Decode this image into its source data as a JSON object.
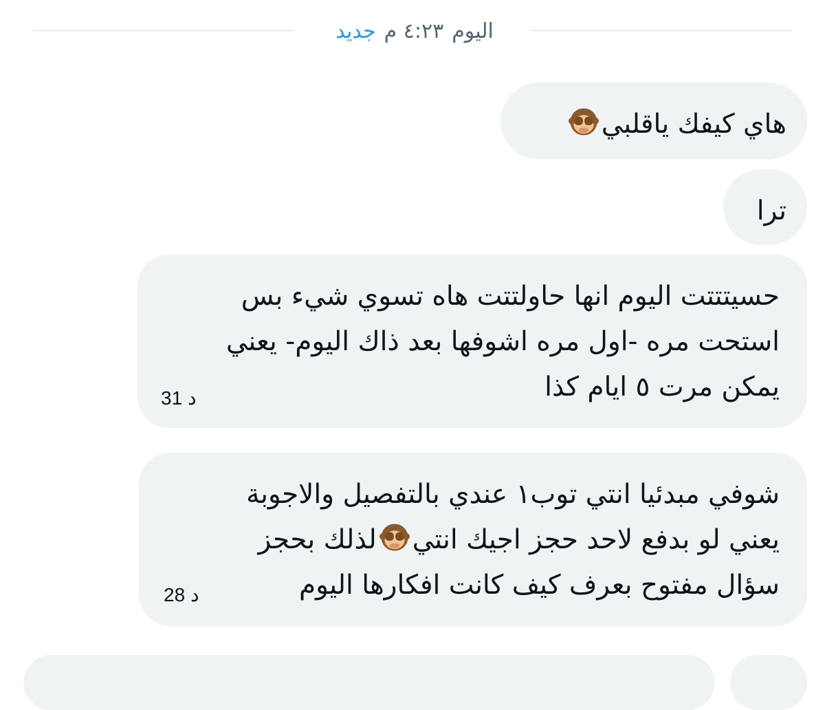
{
  "divider": {
    "day": "اليوم",
    "time": "٤:٢٣ م",
    "new_label": "جديد"
  },
  "messages": [
    {
      "id": "m1",
      "text": "هاي كيفك ياقلبي",
      "emoji": "see-no-evil-monkey"
    },
    {
      "id": "m2",
      "text": "ترا"
    },
    {
      "id": "m3",
      "lines": [
        "حسيتتتت اليوم انها حاولتتت هاه تسوي شيء بس",
        "استحت مره -اول مره اشوفها بعد ذاك اليوم- يعني",
        "يمكن مرت ٥ ايام كذا"
      ],
      "time_value": "31",
      "time_unit": "د"
    },
    {
      "id": "m4",
      "line1": "شوفي مبدئيا انتي توب١ عندي بالتفصيل والاجوبة",
      "line2_before_emoji": "يعني لو بدفع لاحد حجز اجيك انتي",
      "emoji": "see-no-evil-monkey",
      "line2_after_emoji": "لذلك بحجز",
      "line3": "سؤال مفتوح بعرف كيف كانت افكارها اليوم",
      "time_value": "28",
      "time_unit": "د"
    }
  ],
  "colors": {
    "bubble": "#eff3f4",
    "accent": "#1d9bf0",
    "secondary_text": "#536471",
    "text": "#0f1419",
    "divider_line": "#d6dbdf",
    "monkey_fur": "#8b5a2b",
    "monkey_face": "#f2c38f"
  }
}
